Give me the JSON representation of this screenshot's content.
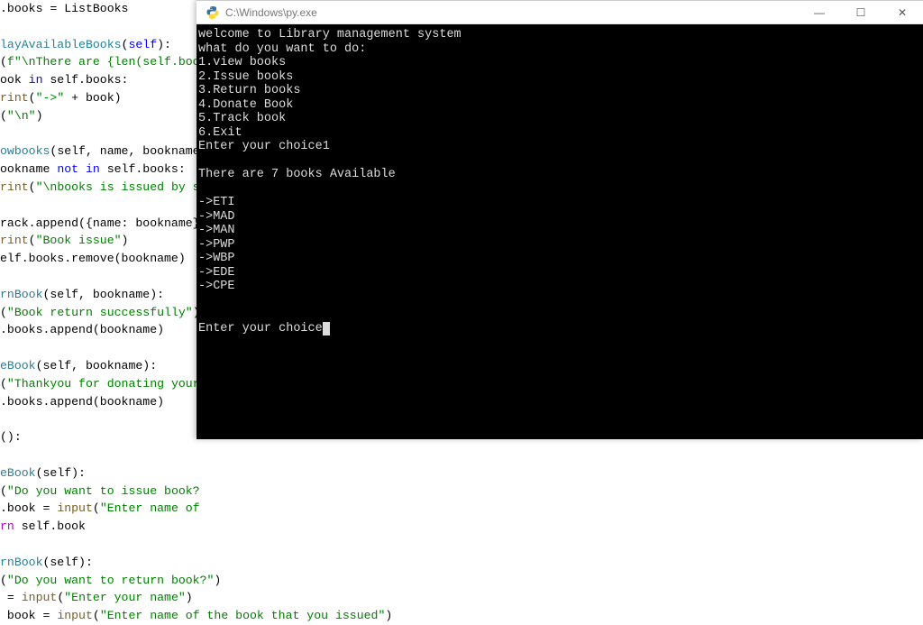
{
  "editor": {
    "lines": [
      {
        "segments": [
          {
            "t": ".books = ListBooks"
          }
        ]
      },
      {
        "segments": []
      },
      {
        "segments": [
          {
            "t": "layAvailableBooks",
            "cls": "fn"
          },
          {
            "t": "("
          },
          {
            "t": "self",
            "cls": "self"
          },
          {
            "t": "):"
          }
        ]
      },
      {
        "segments": [
          {
            "t": "("
          },
          {
            "t": "f\"\\nThere are {len(self.boo",
            "cls": "str"
          }
        ]
      },
      {
        "segments": [
          {
            "t": "ook "
          },
          {
            "t": "in",
            "cls": "inkw"
          },
          {
            "t": " self.books:"
          }
        ]
      },
      {
        "segments": [
          {
            "t": "rint",
            "cls": "plum"
          },
          {
            "t": "("
          },
          {
            "t": "\"->\"",
            "cls": "str"
          },
          {
            "t": " + book)"
          }
        ]
      },
      {
        "segments": [
          {
            "t": "("
          },
          {
            "t": "\"\\n\"",
            "cls": "str"
          },
          {
            "t": ")"
          }
        ]
      },
      {
        "segments": []
      },
      {
        "segments": [
          {
            "t": "owbooks",
            "cls": "fn"
          },
          {
            "t": "(self, name, bookname"
          }
        ]
      },
      {
        "segments": [
          {
            "t": "ookname "
          },
          {
            "t": "not in",
            "cls": "notkw"
          },
          {
            "t": " self.books:"
          }
        ]
      },
      {
        "segments": [
          {
            "t": "rint",
            "cls": "plum"
          },
          {
            "t": "("
          },
          {
            "t": "\"\\nbooks is issued by s",
            "cls": "str"
          }
        ]
      },
      {
        "segments": []
      },
      {
        "segments": [
          {
            "t": "rack.append({name: bookname}"
          }
        ]
      },
      {
        "segments": [
          {
            "t": "rint",
            "cls": "plum"
          },
          {
            "t": "("
          },
          {
            "t": "\"Book issue\"",
            "cls": "str"
          },
          {
            "t": ")"
          }
        ]
      },
      {
        "segments": [
          {
            "t": "elf.books.remove(bookname)"
          }
        ]
      },
      {
        "segments": []
      },
      {
        "segments": [
          {
            "t": "rnBook",
            "cls": "fn"
          },
          {
            "t": "(self, bookname):"
          }
        ]
      },
      {
        "segments": [
          {
            "t": "("
          },
          {
            "t": "\"Book return successfully\"",
            "cls": "str"
          },
          {
            "t": ")"
          }
        ]
      },
      {
        "segments": [
          {
            "t": ".books.append(bookname)"
          }
        ]
      },
      {
        "segments": []
      },
      {
        "segments": [
          {
            "t": "eBook",
            "cls": "fn"
          },
          {
            "t": "(self, bookname):"
          }
        ]
      },
      {
        "segments": [
          {
            "t": "("
          },
          {
            "t": "\"Thankyou for donating your",
            "cls": "str"
          }
        ]
      },
      {
        "segments": [
          {
            "t": ".books.append(bookname)"
          }
        ]
      },
      {
        "segments": []
      },
      {
        "segments": [
          {
            "t": "():"
          }
        ]
      },
      {
        "segments": []
      },
      {
        "segments": [
          {
            "t": "eBook",
            "cls": "fn"
          },
          {
            "t": "(self):"
          }
        ]
      },
      {
        "segments": [
          {
            "t": "("
          },
          {
            "t": "\"Do you want to issue book?",
            "cls": "str"
          }
        ]
      },
      {
        "segments": [
          {
            "t": ".book = "
          },
          {
            "t": "input",
            "cls": "plum"
          },
          {
            "t": "("
          },
          {
            "t": "\"Enter name of ",
            "cls": "str"
          }
        ]
      },
      {
        "segments": [
          {
            "t": "rn",
            "cls": "ret"
          },
          {
            "t": " self.book"
          }
        ]
      },
      {
        "segments": []
      },
      {
        "segments": [
          {
            "t": "rnBook",
            "cls": "fn"
          },
          {
            "t": "(self):"
          }
        ]
      },
      {
        "segments": [
          {
            "t": "("
          },
          {
            "t": "\"Do you want to return book?\"",
            "cls": "str"
          },
          {
            "t": ")"
          }
        ]
      },
      {
        "segments": [
          {
            "t": " = "
          },
          {
            "t": "input",
            "cls": "plum"
          },
          {
            "t": "("
          },
          {
            "t": "\"Enter your name\"",
            "cls": "str"
          },
          {
            "t": ")"
          }
        ]
      },
      {
        "segments": [
          {
            "t": " book = "
          },
          {
            "t": "input",
            "cls": "plum"
          },
          {
            "t": "("
          },
          {
            "t": "\"Enter name of the book that you issued\"",
            "cls": "str"
          },
          {
            "t": ")"
          }
        ]
      }
    ]
  },
  "console": {
    "title": "C:\\Windows\\py.exe",
    "output": [
      "welcome to Library management system",
      "what do you want to do:",
      "1.view books",
      "2.Issue books",
      "3.Return books",
      "4.Donate Book",
      "5.Track book",
      "6.Exit",
      "Enter your choice1",
      "",
      "There are 7 books Available",
      "",
      "->ETI",
      "->MAD",
      "->MAN",
      "->PWP",
      "->WBP",
      "->EDE",
      "->CPE",
      "",
      "",
      "Enter your choice"
    ]
  },
  "winbtns": {
    "min": "—",
    "max": "☐",
    "close": "✕"
  }
}
